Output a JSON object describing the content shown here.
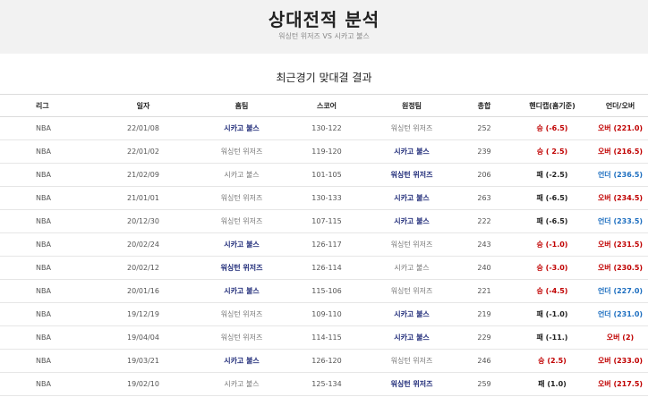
{
  "header": {
    "title": "상대전적 분석",
    "subtitle": "워싱턴 위저즈 VS 시카고 불스"
  },
  "section_title": "최근경기 맞대결 결과",
  "columns": [
    "리그",
    "일자",
    "홈팀",
    "스코어",
    "원정팀",
    "총합",
    "핸디캡(홈기준)",
    "언더/오버"
  ],
  "rows": [
    {
      "league": "NBA",
      "date": "22/01/08",
      "home": "시카고 불스",
      "score": "130-122",
      "away": "워싱턴 위저즈",
      "total": "252",
      "winner": "home",
      "handicap": "승 (-6.5)",
      "hc_result": "win",
      "ou": "오버 (221.0)",
      "ou_result": "over"
    },
    {
      "league": "NBA",
      "date": "22/01/02",
      "home": "워싱턴 위저즈",
      "score": "119-120",
      "away": "시카고 불스",
      "total": "239",
      "winner": "away",
      "handicap": "승 ( 2.5)",
      "hc_result": "win",
      "ou": "오버 (216.5)",
      "ou_result": "over"
    },
    {
      "league": "NBA",
      "date": "21/02/09",
      "home": "시카고 불스",
      "score": "101-105",
      "away": "워싱턴 위저즈",
      "total": "206",
      "winner": "away",
      "handicap": "패 (-2.5)",
      "hc_result": "lose",
      "ou": "언더 (236.5)",
      "ou_result": "under"
    },
    {
      "league": "NBA",
      "date": "21/01/01",
      "home": "워싱턴 위저즈",
      "score": "130-133",
      "away": "시카고 불스",
      "total": "263",
      "winner": "away",
      "handicap": "패 (-6.5)",
      "hc_result": "lose",
      "ou": "오버 (234.5)",
      "ou_result": "over"
    },
    {
      "league": "NBA",
      "date": "20/12/30",
      "home": "워싱턴 위저즈",
      "score": "107-115",
      "away": "시카고 불스",
      "total": "222",
      "winner": "away",
      "handicap": "패 (-6.5)",
      "hc_result": "lose",
      "ou": "언더 (233.5)",
      "ou_result": "under"
    },
    {
      "league": "NBA",
      "date": "20/02/24",
      "home": "시카고 불스",
      "score": "126-117",
      "away": "워싱턴 위저즈",
      "total": "243",
      "winner": "home",
      "handicap": "승 (-1.0)",
      "hc_result": "win",
      "ou": "오버 (231.5)",
      "ou_result": "over"
    },
    {
      "league": "NBA",
      "date": "20/02/12",
      "home": "워싱턴 위저즈",
      "score": "126-114",
      "away": "시카고 불스",
      "total": "240",
      "winner": "home",
      "handicap": "승 (-3.0)",
      "hc_result": "win",
      "ou": "오버 (230.5)",
      "ou_result": "over"
    },
    {
      "league": "NBA",
      "date": "20/01/16",
      "home": "시카고 불스",
      "score": "115-106",
      "away": "워싱턴 위저즈",
      "total": "221",
      "winner": "home",
      "handicap": "승 (-4.5)",
      "hc_result": "win",
      "ou": "언더 (227.0)",
      "ou_result": "under"
    },
    {
      "league": "NBA",
      "date": "19/12/19",
      "home": "워싱턴 위저즈",
      "score": "109-110",
      "away": "시카고 불스",
      "total": "219",
      "winner": "away",
      "handicap": "패 (-1.0)",
      "hc_result": "lose",
      "ou": "언더 (231.0)",
      "ou_result": "under"
    },
    {
      "league": "NBA",
      "date": "19/04/04",
      "home": "워싱턴 위저즈",
      "score": "114-115",
      "away": "시카고 불스",
      "total": "229",
      "winner": "away",
      "handicap": "패 (-11.)",
      "hc_result": "lose",
      "ou": "오버 (2)",
      "ou_result": "over"
    },
    {
      "league": "NBA",
      "date": "19/03/21",
      "home": "시카고 불스",
      "score": "126-120",
      "away": "워싱턴 위저즈",
      "total": "246",
      "winner": "home",
      "handicap": "승 (2.5)",
      "hc_result": "win",
      "ou": "오버 (233.0)",
      "ou_result": "over"
    },
    {
      "league": "NBA",
      "date": "19/02/10",
      "home": "시카고 불스",
      "score": "125-134",
      "away": "워싱턴 위저즈",
      "total": "259",
      "winner": "away",
      "handicap": "패 (1.0)",
      "hc_result": "lose",
      "ou": "오버 (217.5)",
      "ou_result": "over"
    }
  ]
}
